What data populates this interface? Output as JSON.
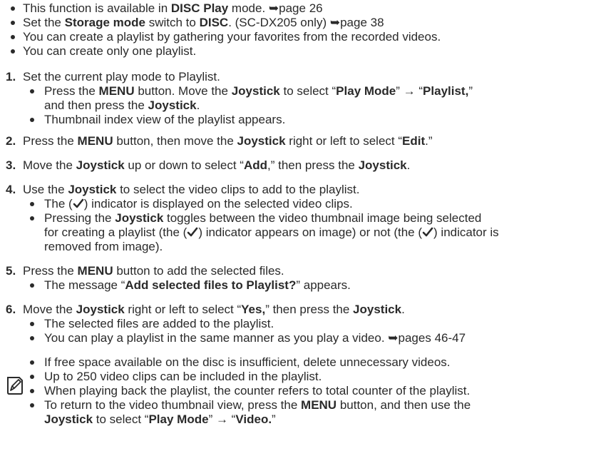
{
  "intro": {
    "b1": {
      "a": "This function is available in ",
      "b": "DISC Play",
      "c": " mode. ",
      "ref": "➥page 26"
    },
    "b2": {
      "a": "Set the ",
      "b": "Storage mode",
      "c": " switch to ",
      "d": "DISC",
      "e": ". (SC-DX205 only) ",
      "ref": "➥page 38"
    },
    "b3": "You can create a playlist by gathering your favorites from the recorded videos.",
    "b4": "You can create only one playlist."
  },
  "steps": {
    "s1": {
      "n": "1.",
      "text": "Set the current play mode to Playlist.",
      "sub1": {
        "a": "Press the ",
        "menu": "MENU",
        "b": " button. Move the ",
        "joy": "Joystick",
        "c": " to select “",
        "pm": "Play Mode",
        "d": "” → “",
        "pl": "Playlist,",
        "e": "”"
      },
      "sub1b": {
        "a": "and then press the ",
        "joy": "Joystick",
        "b": "."
      },
      "sub2": "Thumbnail index view of the playlist appears."
    },
    "s2": {
      "n": "2.",
      "a": "Press the ",
      "menu": "MENU",
      "b": " button, then move the ",
      "joy": "Joystick",
      "c": " right or left to select “",
      "edit": "Edit",
      "d": ".”"
    },
    "s3": {
      "n": "3.",
      "a": "Move the ",
      "joy": "Joystick",
      "b": " up or down to select “",
      "add": "Add",
      "c": ",” then press the ",
      "joy2": "Joystick",
      "d": "."
    },
    "s4": {
      "n": "4.",
      "a": "Use the ",
      "joy": "Joystick",
      "b": " to select the video clips to add to the playlist.",
      "sub1": {
        "a": "The (",
        "b": ") indicator is displayed on the selected video clips."
      },
      "sub2": {
        "a": "Pressing the ",
        "joy": "Joystick",
        "b": " toggles between the video thumbnail image being selected"
      },
      "sub2b": {
        "a": "for creating a playlist (the (",
        "b": ") indicator appears on image) or not (the (",
        "c": ") indicator is"
      },
      "sub2c": "removed from image)."
    },
    "s5": {
      "n": "5.",
      "a": "Press the ",
      "menu": "MENU",
      "b": " button to add the selected files.",
      "sub1": {
        "a": "The message “",
        "msg": "Add selected files to Playlist?",
        "b": "” appears."
      }
    },
    "s6": {
      "n": "6.",
      "a": "Move the ",
      "joy": "Joystick",
      "b": " right or left to select “",
      "yes": "Yes,",
      "c": "” then press the ",
      "joy2": "Joystick",
      "d": ".",
      "sub1": "The selected files are added to the playlist.",
      "sub2": {
        "a": "You can play a playlist in the same manner as you play a video. ",
        "ref": "➥pages 46-47"
      }
    }
  },
  "notes": {
    "n1": "If free space available on the disc is insufficient, delete unnecessary videos.",
    "n2": "Up to 250 video clips can be included in the playlist.",
    "n3": "When playing back the playlist, the counter refers to total counter of the playlist.",
    "n4": {
      "a": "To return to the video thumbnail view, press the ",
      "menu": "MENU",
      "b": " button, and then use the"
    },
    "n4b": {
      "joy": "Joystick",
      "a": " to select “",
      "pm": "Play Mode",
      "b": "” → “",
      "vid": "Video.",
      "c": "”"
    }
  },
  "icons": {
    "check": "check-indicator-icon",
    "note": "note-pencil-icon"
  }
}
